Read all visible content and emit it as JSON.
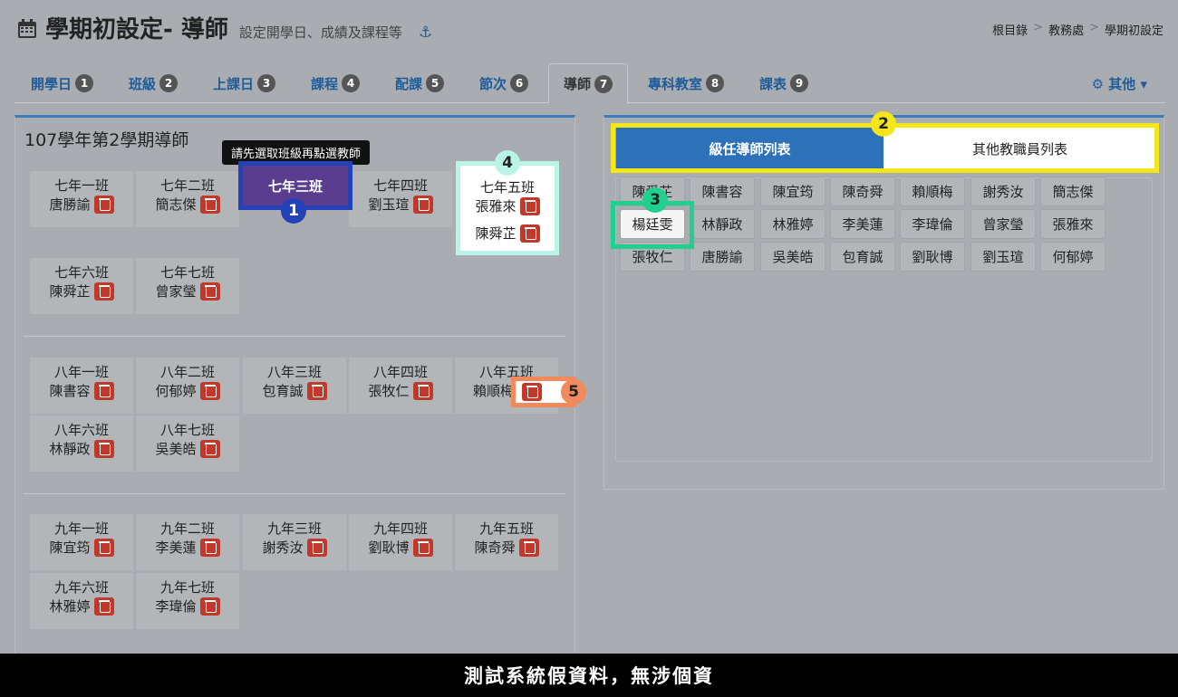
{
  "header": {
    "title": "學期初設定- 導師",
    "subtitle": "設定開學日、成績及課程等",
    "anchor": "⚓",
    "breadcrumb": [
      "根目錄",
      "教務處",
      "學期初設定"
    ],
    "breadcrumb_sep": ">"
  },
  "tabs": [
    {
      "label": "開學日",
      "num": "1"
    },
    {
      "label": "班級",
      "num": "2"
    },
    {
      "label": "上課日",
      "num": "3"
    },
    {
      "label": "課程",
      "num": "4"
    },
    {
      "label": "配課",
      "num": "5"
    },
    {
      "label": "節次",
      "num": "6"
    },
    {
      "label": "導師",
      "num": "7"
    },
    {
      "label": "專科教室",
      "num": "8"
    },
    {
      "label": "課表",
      "num": "9"
    }
  ],
  "other_menu": "⚙ 其他 ▾",
  "left_panel": {
    "title": "107學年第2學期導師",
    "tooltip": "請先選取班級再點選教師",
    "selected_class": "七年三班",
    "grade7": [
      {
        "cls": "七年一班",
        "teacher": "唐勝諭"
      },
      {
        "cls": "七年二班",
        "teacher": "簡志傑"
      },
      {
        "cls": "七年四班",
        "teacher": "劉玉瑄"
      },
      {
        "cls": "七年五班",
        "teacher": "張雅來",
        "teacher2": "陳舜芷"
      },
      {
        "cls": "七年六班",
        "teacher": "陳舜芷"
      },
      {
        "cls": "七年七班",
        "teacher": "曾家瑩"
      }
    ],
    "grade8": [
      {
        "cls": "八年一班",
        "teacher": "陳書容"
      },
      {
        "cls": "八年二班",
        "teacher": "何郁婷"
      },
      {
        "cls": "八年三班",
        "teacher": "包育誠"
      },
      {
        "cls": "八年四班",
        "teacher": "張牧仁"
      },
      {
        "cls": "八年五班",
        "teacher": "賴順梅"
      },
      {
        "cls": "八年六班",
        "teacher": "林靜政"
      },
      {
        "cls": "八年七班",
        "teacher": "吳美皓"
      }
    ],
    "grade9": [
      {
        "cls": "九年一班",
        "teacher": "陳宜筠"
      },
      {
        "cls": "九年二班",
        "teacher": "李美蓮"
      },
      {
        "cls": "九年三班",
        "teacher": "謝秀汝"
      },
      {
        "cls": "九年四班",
        "teacher": "劉耿博"
      },
      {
        "cls": "九年五班",
        "teacher": "陳奇舜"
      },
      {
        "cls": "九年六班",
        "teacher": "林雅婷"
      },
      {
        "cls": "九年七班",
        "teacher": "李瑋倫"
      }
    ]
  },
  "right_panel": {
    "seg_on": "級任導師列表",
    "seg_off": "其他教職員列表",
    "teachers": [
      "陳舜芷",
      "陳書容",
      "陳宜筠",
      "陳奇舜",
      "賴順梅",
      "謝秀汝",
      "簡志傑",
      "楊廷雯",
      "林靜政",
      "林雅婷",
      "李美蓮",
      "李瑋倫",
      "曾家瑩",
      "張雅來",
      "張牧仁",
      "唐勝諭",
      "吳美皓",
      "包育誠",
      "劉耿博",
      "劉玉瑄",
      "何郁婷"
    ]
  },
  "badges": [
    "1",
    "2",
    "3",
    "4",
    "5"
  ],
  "footer": "測試系統假資料，無涉個資",
  "colors": {
    "accent": "#2d72b8",
    "badge1": "#2442b8",
    "badge2": "#f5e61a",
    "badge3": "#1fd08e",
    "badge4": "#b8f5e6",
    "badge5": "#f08a5d",
    "trash": "#c0392b"
  }
}
